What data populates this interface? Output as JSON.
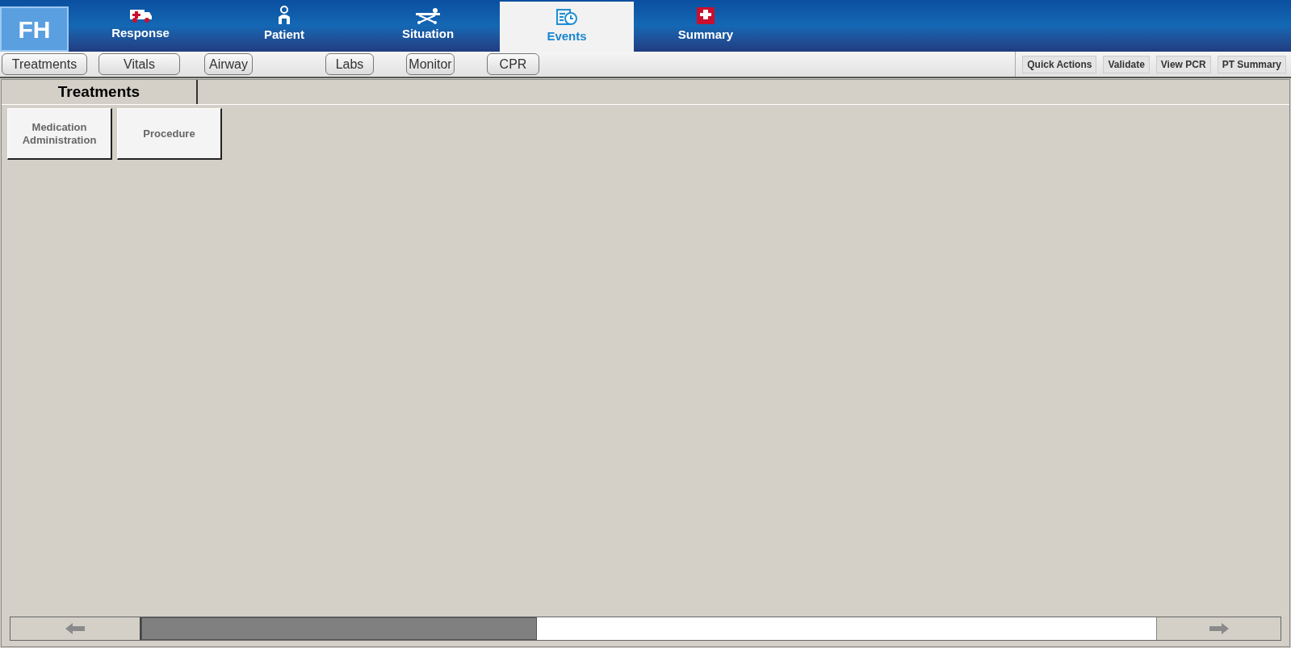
{
  "logo": "FH",
  "main_tabs": [
    {
      "label": "Response",
      "kind": "ambulance",
      "selected": false
    },
    {
      "label": "Patient",
      "kind": "patient",
      "selected": false
    },
    {
      "label": "Situation",
      "kind": "stretcher",
      "selected": false
    },
    {
      "label": "Events",
      "kind": "events",
      "selected": true
    },
    {
      "label": "Summary",
      "kind": "hospital",
      "selected": false
    }
  ],
  "sub_tabs": [
    "Treatments",
    "Vitals",
    "Airway",
    "Labs",
    "Monitor",
    "CPR"
  ],
  "actions": [
    "Quick Actions",
    "Validate",
    "View PCR",
    "PT Summary"
  ],
  "panel": {
    "tab": "Treatments",
    "buttons": [
      "Medication\nAdministration",
      "Procedure"
    ]
  }
}
